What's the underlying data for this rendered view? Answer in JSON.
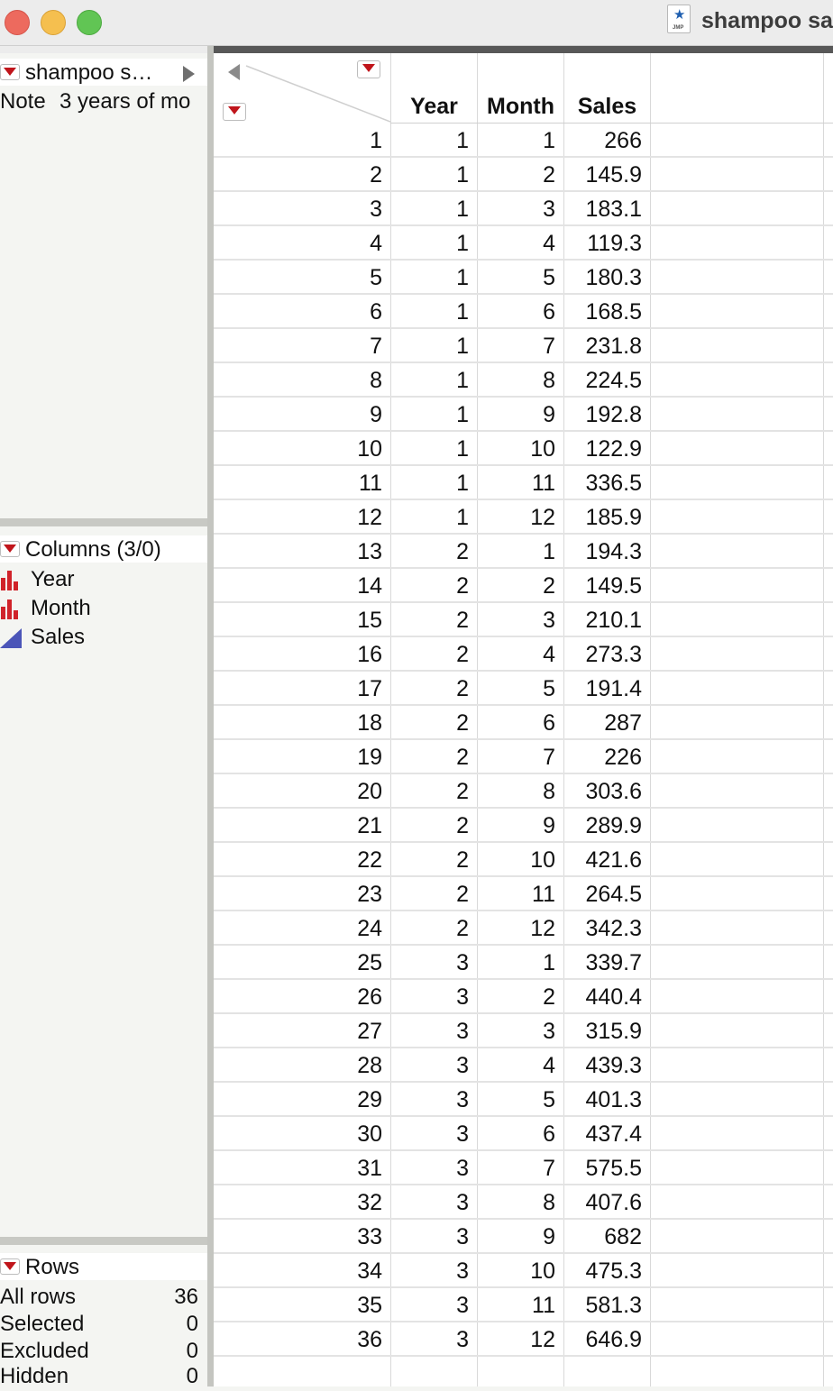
{
  "window": {
    "title": "shampoo sa"
  },
  "table_panel": {
    "title": "shampoo s…",
    "note_label": "Note",
    "note_value": "3 years of mo"
  },
  "columns_panel": {
    "title": "Columns (3/0)",
    "items": [
      {
        "name": "Year",
        "icon": "nominal-bar-icon"
      },
      {
        "name": "Month",
        "icon": "nominal-bar-icon"
      },
      {
        "name": "Sales",
        "icon": "continuous-triangle-icon"
      }
    ]
  },
  "rows_panel": {
    "title": "Rows",
    "stats": [
      {
        "label": "All rows",
        "value": "36"
      },
      {
        "label": "Selected",
        "value": "0"
      },
      {
        "label": "Excluded",
        "value": "0"
      },
      {
        "label": "Hidden",
        "value": "0"
      }
    ]
  },
  "grid": {
    "headers": [
      "Year",
      "Month",
      "Sales"
    ],
    "rows": [
      [
        "1",
        "1",
        "1",
        "266"
      ],
      [
        "2",
        "1",
        "2",
        "145.9"
      ],
      [
        "3",
        "1",
        "3",
        "183.1"
      ],
      [
        "4",
        "1",
        "4",
        "119.3"
      ],
      [
        "5",
        "1",
        "5",
        "180.3"
      ],
      [
        "6",
        "1",
        "6",
        "168.5"
      ],
      [
        "7",
        "1",
        "7",
        "231.8"
      ],
      [
        "8",
        "1",
        "8",
        "224.5"
      ],
      [
        "9",
        "1",
        "9",
        "192.8"
      ],
      [
        "10",
        "1",
        "10",
        "122.9"
      ],
      [
        "11",
        "1",
        "11",
        "336.5"
      ],
      [
        "12",
        "1",
        "12",
        "185.9"
      ],
      [
        "13",
        "2",
        "1",
        "194.3"
      ],
      [
        "14",
        "2",
        "2",
        "149.5"
      ],
      [
        "15",
        "2",
        "3",
        "210.1"
      ],
      [
        "16",
        "2",
        "4",
        "273.3"
      ],
      [
        "17",
        "2",
        "5",
        "191.4"
      ],
      [
        "18",
        "2",
        "6",
        "287"
      ],
      [
        "19",
        "2",
        "7",
        "226"
      ],
      [
        "20",
        "2",
        "8",
        "303.6"
      ],
      [
        "21",
        "2",
        "9",
        "289.9"
      ],
      [
        "22",
        "2",
        "10",
        "421.6"
      ],
      [
        "23",
        "2",
        "11",
        "264.5"
      ],
      [
        "24",
        "2",
        "12",
        "342.3"
      ],
      [
        "25",
        "3",
        "1",
        "339.7"
      ],
      [
        "26",
        "3",
        "2",
        "440.4"
      ],
      [
        "27",
        "3",
        "3",
        "315.9"
      ],
      [
        "28",
        "3",
        "4",
        "439.3"
      ],
      [
        "29",
        "3",
        "5",
        "401.3"
      ],
      [
        "30",
        "3",
        "6",
        "437.4"
      ],
      [
        "31",
        "3",
        "7",
        "575.5"
      ],
      [
        "32",
        "3",
        "8",
        "407.6"
      ],
      [
        "33",
        "3",
        "9",
        "682"
      ],
      [
        "34",
        "3",
        "10",
        "475.3"
      ],
      [
        "35",
        "3",
        "11",
        "581.3"
      ],
      [
        "36",
        "3",
        "12",
        "646.9"
      ]
    ]
  },
  "colors": {
    "accent_red": "#c0151b",
    "continuous_blue": "#4b55b8"
  }
}
